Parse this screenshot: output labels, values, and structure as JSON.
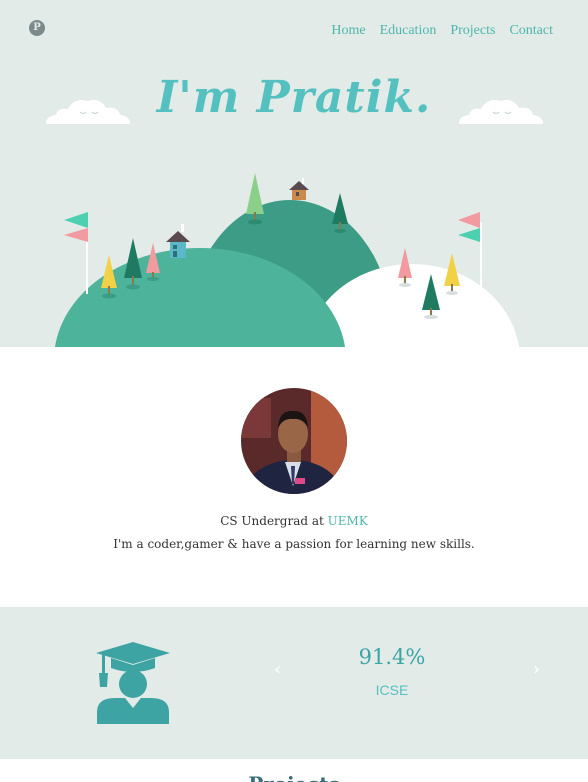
{
  "logo": {
    "letter": "P"
  },
  "nav": {
    "items": [
      "Home",
      "Education",
      "Projects",
      "Contact"
    ]
  },
  "hero": {
    "title": "I'm Pratik."
  },
  "about": {
    "role_prefix": "CS Undergrad at ",
    "school": "UEMK",
    "bio": "I'm a coder,gamer & have a passion for learning new skills."
  },
  "education": {
    "score": "91.4%",
    "board": "ICSE",
    "prev_arrow": "‹",
    "next_arrow": "›",
    "icon": "graduate-icon"
  },
  "projects": {
    "title": "Projects"
  },
  "colors": {
    "accent": "#54c1c0",
    "hill_dark": "#3d9c86",
    "hill_light": "#4db39a",
    "hero_bg": "#e2ebe8"
  }
}
